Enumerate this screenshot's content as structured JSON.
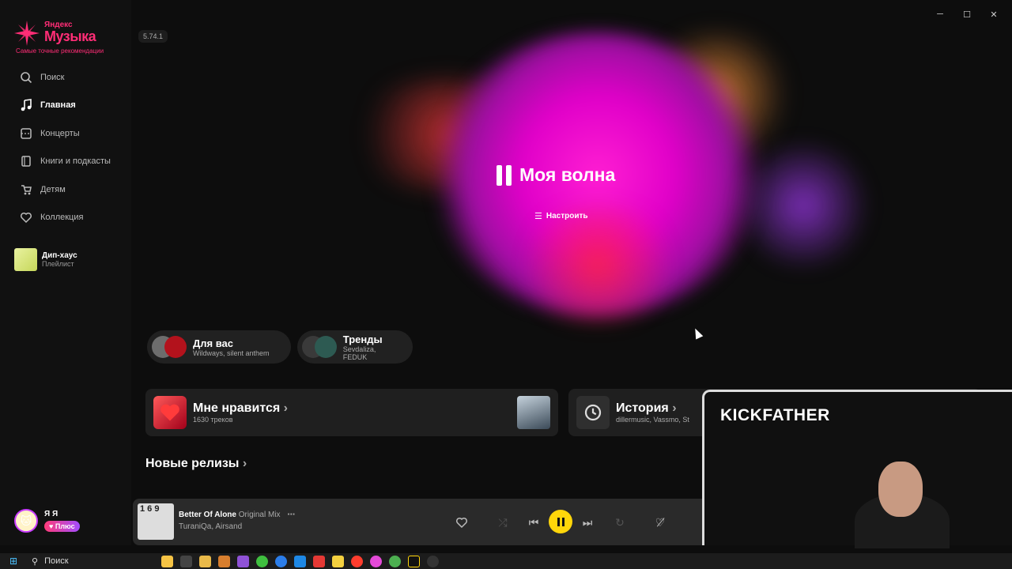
{
  "app": {
    "logo_small": "Яндекс",
    "logo_big": "Музыка",
    "tagline": "Самые точные рекомендации",
    "version": "5.74.1",
    "accent": "#ff2d76"
  },
  "window_controls": {
    "minimize": "─",
    "maximize": "☐",
    "close": "✕"
  },
  "sidebar": {
    "items": [
      {
        "label": "Поиск",
        "icon": "search-icon",
        "active": false
      },
      {
        "label": "Главная",
        "icon": "music-note-icon",
        "active": true
      },
      {
        "label": "Концерты",
        "icon": "ticket-icon",
        "active": false
      },
      {
        "label": "Книги и подкасты",
        "icon": "book-icon",
        "active": false
      },
      {
        "label": "Детям",
        "icon": "stroller-icon",
        "active": false
      },
      {
        "label": "Коллекция",
        "icon": "heart-icon",
        "active": false
      }
    ],
    "playlist": {
      "title": "Дип-хаус",
      "subtitle": "Плейлист"
    },
    "user": {
      "name": "Я Я",
      "plus_label": "Плюс"
    }
  },
  "wave": {
    "title": "Моя волна",
    "tune_label": "Настроить"
  },
  "chips": [
    {
      "title": "Для вас",
      "subtitle": "Wildways, silent anthem"
    },
    {
      "title": "Тренды",
      "subtitle": "Sevdaliza, FEDUK"
    }
  ],
  "cards": [
    {
      "title": "Мне нравится",
      "subtitle": "1630 треков"
    },
    {
      "title": "История",
      "subtitle": "dillermusic, Vassmo, St"
    }
  ],
  "new_releases": {
    "title": "Новые релизы"
  },
  "player": {
    "cover_text": "1 6 9",
    "track_title": "Better Of Alone",
    "track_version": "Original Mix",
    "artist": "TuraniQa, Airsand"
  },
  "overlay": {
    "name": "KICKFATHER"
  },
  "taskbar": {
    "search_label": "Поиск"
  }
}
